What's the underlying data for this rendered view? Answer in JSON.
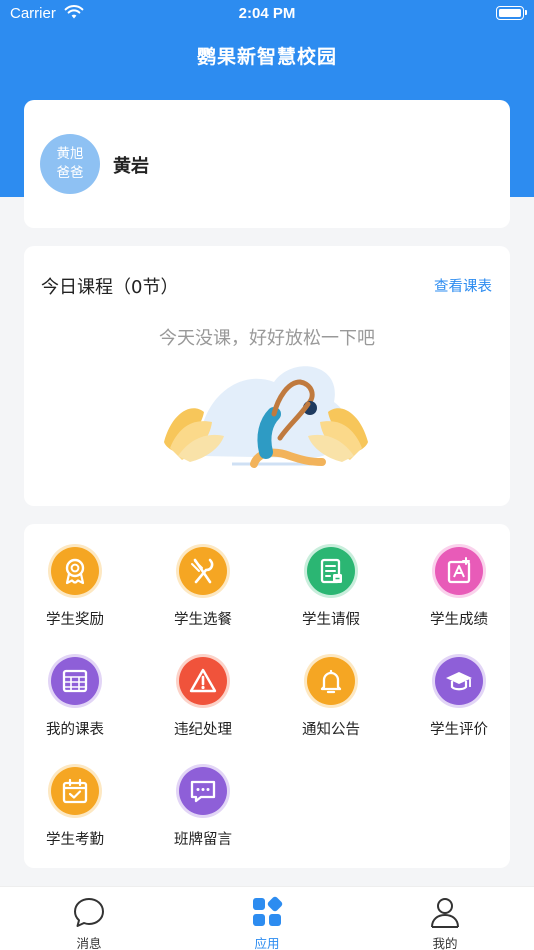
{
  "status_bar": {
    "carrier": "Carrier",
    "time": "2:04 PM"
  },
  "nav": {
    "title": "鹦果新智慧校园"
  },
  "profile": {
    "avatar_line1": "黄旭",
    "avatar_line2": "爸爸",
    "name": "黄岩"
  },
  "course": {
    "title": "今日课程（0节）",
    "link": "查看课表",
    "empty_message": "今天没课，好好放松一下吧"
  },
  "apps": [
    {
      "label": "学生奖励",
      "icon": "award-icon",
      "color": "#f5a623"
    },
    {
      "label": "学生选餐",
      "icon": "fork-knife-icon",
      "color": "#f5a623"
    },
    {
      "label": "学生请假",
      "icon": "leave-document-icon",
      "color": "#2bb673"
    },
    {
      "label": "学生成绩",
      "icon": "grade-icon",
      "color": "#e85bb8"
    },
    {
      "label": "我的课表",
      "icon": "calendar-grid-icon",
      "color": "#8e5fd8"
    },
    {
      "label": "违纪处理",
      "icon": "warning-icon",
      "color": "#f0533b"
    },
    {
      "label": "通知公告",
      "icon": "bell-icon",
      "color": "#f5a623"
    },
    {
      "label": "学生评价",
      "icon": "graduation-cap-icon",
      "color": "#8e5fd8"
    },
    {
      "label": "学生考勤",
      "icon": "attendance-calendar-icon",
      "color": "#f5a623"
    },
    {
      "label": "班牌留言",
      "icon": "message-icon",
      "color": "#8e5fd8"
    }
  ],
  "tabbar": [
    {
      "label": "消息",
      "icon": "chat-bubble-icon",
      "active": false
    },
    {
      "label": "应用",
      "icon": "apps-grid-icon",
      "active": true
    },
    {
      "label": "我的",
      "icon": "person-icon",
      "active": false
    }
  ],
  "colors": {
    "primary": "#2d8cf0",
    "background": "#f4f5f7"
  }
}
